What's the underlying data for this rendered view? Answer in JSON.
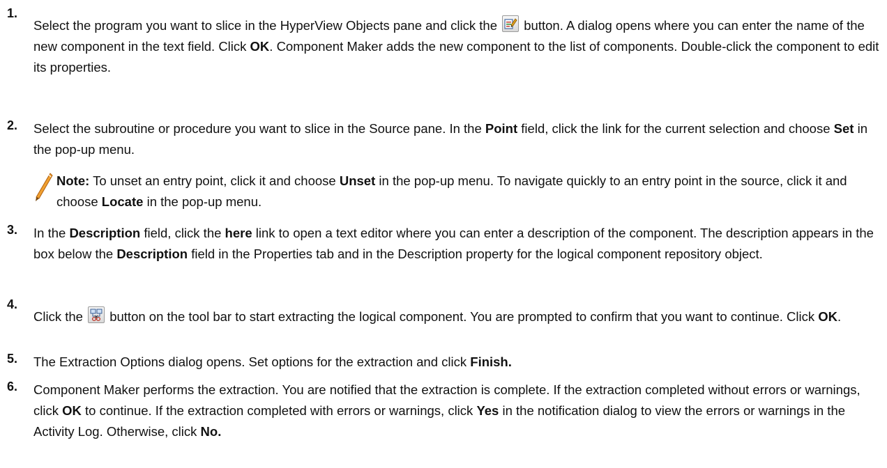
{
  "steps": [
    {
      "number": "1.",
      "parts": [
        {
          "t": "text",
          "v": "Select the program you want to slice in the HyperView Objects pane and click the "
        },
        {
          "t": "icon",
          "name": "new-component-icon"
        },
        {
          "t": "text",
          "v": " button. A dialog opens where you can enter the name of the new component in the text field. Click "
        },
        {
          "t": "bold",
          "v": "OK"
        },
        {
          "t": "text",
          "v": ". Component Maker adds the new component to the list of components. Double-click the component to edit its properties."
        }
      ]
    },
    {
      "number": "2.",
      "parts": [
        {
          "t": "text",
          "v": "Select the subroutine or procedure you want to slice in the Source pane. In the "
        },
        {
          "t": "bold",
          "v": "Point"
        },
        {
          "t": "text",
          "v": " field, click the link for the current selection and choose "
        },
        {
          "t": "bold",
          "v": "Set"
        },
        {
          "t": "text",
          "v": " in the pop-up menu."
        }
      ]
    },
    {
      "number": "3.",
      "parts": [
        {
          "t": "text",
          "v": "In the "
        },
        {
          "t": "bold",
          "v": "Description"
        },
        {
          "t": "text",
          "v": " field, click the "
        },
        {
          "t": "bold",
          "v": "here"
        },
        {
          "t": "text",
          "v": " link to open a text editor where you can enter a description of the component. The description appears in the box below the "
        },
        {
          "t": "bold",
          "v": "Description"
        },
        {
          "t": "text",
          "v": " field in the Properties tab and in the Description property for the logical component repository object."
        }
      ]
    },
    {
      "number": "4.",
      "parts": [
        {
          "t": "text",
          "v": "Click the "
        },
        {
          "t": "icon",
          "name": "extract-component-icon"
        },
        {
          "t": "text",
          "v": " button on the tool bar to start extracting the logical component. You are prompted to confirm that you want to continue. Click "
        },
        {
          "t": "bold",
          "v": "OK"
        },
        {
          "t": "text",
          "v": "."
        }
      ]
    },
    {
      "number": "5.",
      "parts": [
        {
          "t": "text",
          "v": "The Extraction Options dialog opens. Set options for the extraction and click "
        },
        {
          "t": "bold",
          "v": "Finish."
        }
      ]
    },
    {
      "number": "6.",
      "parts": [
        {
          "t": "text",
          "v": "Component Maker performs the extraction. You are notified that the extraction is complete. If the extraction completed without errors or warnings, click "
        },
        {
          "t": "bold",
          "v": "OK"
        },
        {
          "t": "text",
          "v": " to continue. If the extraction completed with errors or warnings, click "
        },
        {
          "t": "bold",
          "v": "Yes"
        },
        {
          "t": "text",
          "v": " in the notification dialog to view the errors or warnings in the Activity Log. Otherwise, click "
        },
        {
          "t": "bold",
          "v": "No."
        }
      ]
    }
  ],
  "note": {
    "icon": "pencil-note-icon",
    "label": "Note:",
    "parts": [
      {
        "t": "text",
        "v": " To unset an entry point, click it and choose "
      },
      {
        "t": "bold",
        "v": "Unset"
      },
      {
        "t": "text",
        "v": " in the pop-up menu. To navigate quickly to an entry point in the source, click it and choose "
      },
      {
        "t": "bold",
        "v": "Locate"
      },
      {
        "t": "text",
        "v": " in the pop-up menu."
      }
    ]
  }
}
